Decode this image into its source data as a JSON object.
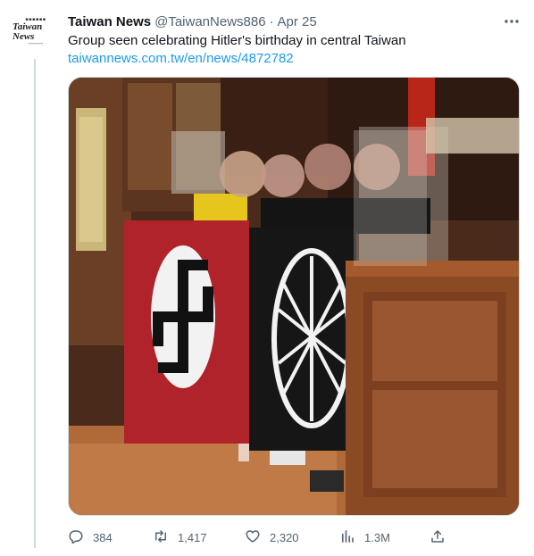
{
  "account": {
    "display_name": "Taiwan News",
    "handle": "@TaiwanNews886",
    "separator": "·",
    "date": "Apr 25",
    "avatar_logo": "Taiwan News"
  },
  "tweet": {
    "text": "Group seen celebrating Hitler's birthday in central Taiwan",
    "link": "taiwannews.com.tw/en/news/4872782"
  },
  "actions": {
    "replies": "384",
    "retweets": "1,417",
    "likes": "2,320",
    "views": "1.3M"
  },
  "icons": {
    "more": "more-horizontal-icon",
    "reply": "reply-icon",
    "retweet": "retweet-icon",
    "like": "heart-icon",
    "views": "analytics-icon",
    "share": "share-icon"
  },
  "colors": {
    "link": "#1d9bf0",
    "secondary_text": "#536471",
    "border": "#cfd9de"
  }
}
